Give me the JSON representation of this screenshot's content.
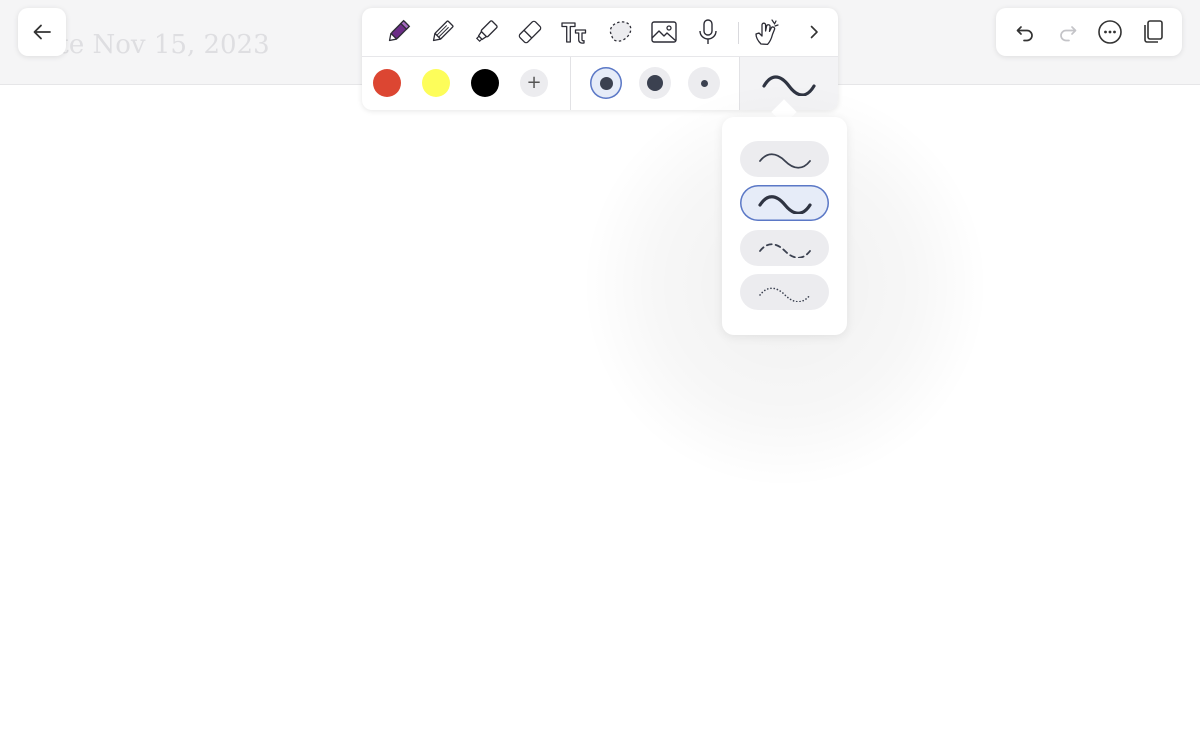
{
  "note": {
    "title": "Note Nov 15, 2023"
  },
  "colors": {
    "accent": "#5b78c6",
    "selected_fill": "#e6ecf8",
    "pen_purple": "#6b2d86",
    "swatch_red": "#dc4632",
    "swatch_yellow": "#fdfd5a",
    "swatch_black": "#000000"
  },
  "top_left": {
    "back_icon": "arrow-left-icon"
  },
  "top_right": {
    "icons": [
      "undo-icon",
      "redo-icon",
      "more-icon",
      "pages-icon"
    ]
  },
  "toolbar": {
    "tools": [
      "pen-icon",
      "pencil-icon",
      "highlighter-icon",
      "eraser-icon",
      "text-tool-icon",
      "lasso-icon",
      "image-icon",
      "microphone-icon",
      "touch-draw-icon",
      "chevron-right-icon"
    ],
    "selected_tool": "pen-icon",
    "add_color_label": "+",
    "stroke_sizes": [
      "medium",
      "large",
      "small"
    ],
    "selected_size": "medium",
    "current_style": "solid-bold"
  },
  "stroke_styles": {
    "options": [
      "solid-thin",
      "solid-bold",
      "dashed",
      "dotted"
    ],
    "selected": "solid-bold"
  }
}
